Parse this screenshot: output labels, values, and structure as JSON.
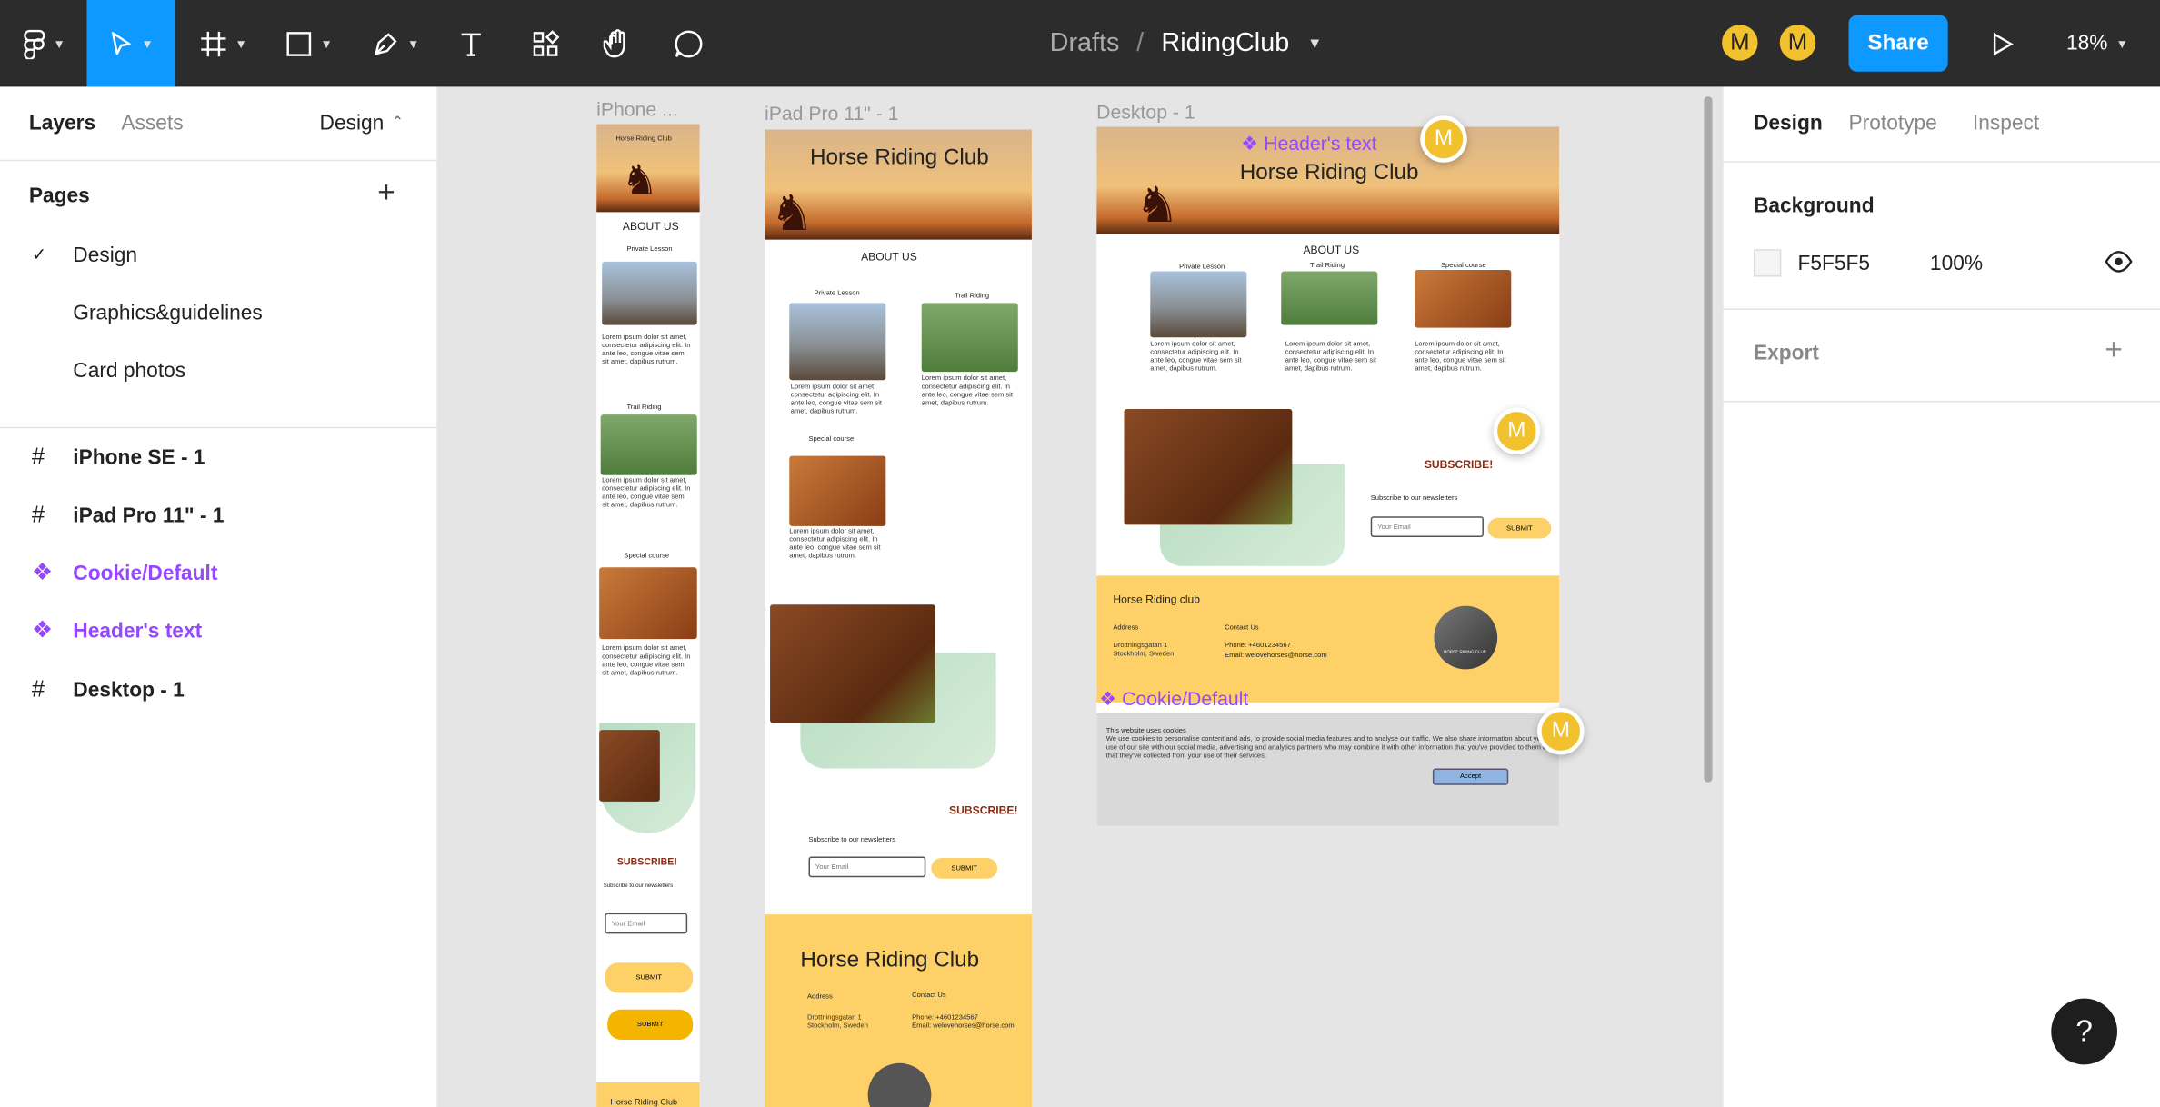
{
  "toolbar": {
    "crumb_drafts": "Drafts",
    "crumb_sep": "/",
    "file_name": "RidingClub",
    "avatar1": "M",
    "avatar2": "M",
    "share_label": "Share",
    "zoom_label": "18%",
    "icons": [
      "figma-menu-icon",
      "move-tool-icon",
      "frame-tool-icon",
      "shape-tool-icon",
      "pen-tool-icon",
      "text-tool-icon",
      "resources-icon",
      "hand-tool-icon",
      "comment-icon",
      "present-icon"
    ]
  },
  "left_panel": {
    "tab_layers": "Layers",
    "tab_assets": "Assets",
    "page_switch": "Design",
    "pages_header": "Pages",
    "pages": [
      {
        "label": "Design",
        "check": "✓"
      },
      {
        "label": "Graphics&guidelines",
        "check": ""
      },
      {
        "label": "Card photos",
        "check": ""
      }
    ],
    "layers": [
      {
        "icon": "#",
        "label": "iPhone SE - 1",
        "kind": "frame"
      },
      {
        "icon": "#",
        "label": "iPad Pro 11\" - 1",
        "kind": "frame"
      },
      {
        "icon": "❖",
        "label": "Cookie/Default",
        "kind": "component"
      },
      {
        "icon": "❖",
        "label": "Header's text",
        "kind": "component"
      },
      {
        "icon": "#",
        "label": "Desktop - 1",
        "kind": "frame"
      }
    ]
  },
  "right_panel": {
    "tab_design": "Design",
    "tab_prototype": "Prototype",
    "tab_inspect": "Inspect",
    "background_label": "Background",
    "bg_hex": "F5F5F5",
    "bg_opacity": "100%",
    "export_label": "Export"
  },
  "canvas": {
    "iphone_label": "iPhone ...",
    "ipad_label": "iPad Pro 11\" - 1",
    "desktop_label": "Desktop - 1",
    "site": {
      "title": "Horse Riding Club",
      "about": "ABOUT US",
      "private": "Private Lesson",
      "trail": "Trail  Riding",
      "special": "Special course",
      "lorem": "Lorem ipsum dolor sit amet, consectetur adipiscing elit. In ante leo, congue vitae sem sit amet, dapibus rutrum.",
      "subscribe": "SUBSCRIBE!",
      "newsletter": "Subscribe to our newsletters",
      "email_placeholder": "Your Email",
      "submit": "SUBMIT",
      "footer_title": "Horse Riding club",
      "address_label": "Address",
      "address": "Drottningsgatan 1 Stockholm, Sweden",
      "contact_label": "Contact Us",
      "phone": "Phone: +4601234567",
      "email": "Email: welovehorses@horse.com",
      "logo_text": "HORSE RIDING CLUB",
      "cookie_title": "This website uses cookies",
      "cookie_text": "We use cookies to personalise content and ads, to provide social media features and to analyse our traffic. We also share information about your use of our site with our social media, advertising and analytics partners who may combine it with other information that you've provided to them or that they've collected from your use of their services.",
      "accept": "Accept",
      "footer_title_ipad": "Horse Riding Club",
      "footer_title_phone": "Horse Riding Club"
    },
    "component_header": "❖ Header's text",
    "component_cookie": "❖ Cookie/Default",
    "cursor_initial": "M"
  },
  "help_label": "?",
  "colors": {
    "accent": "#0d99ff",
    "component": "#9747ff",
    "avatar": "#f2c12e",
    "footer": "#fdd168"
  }
}
